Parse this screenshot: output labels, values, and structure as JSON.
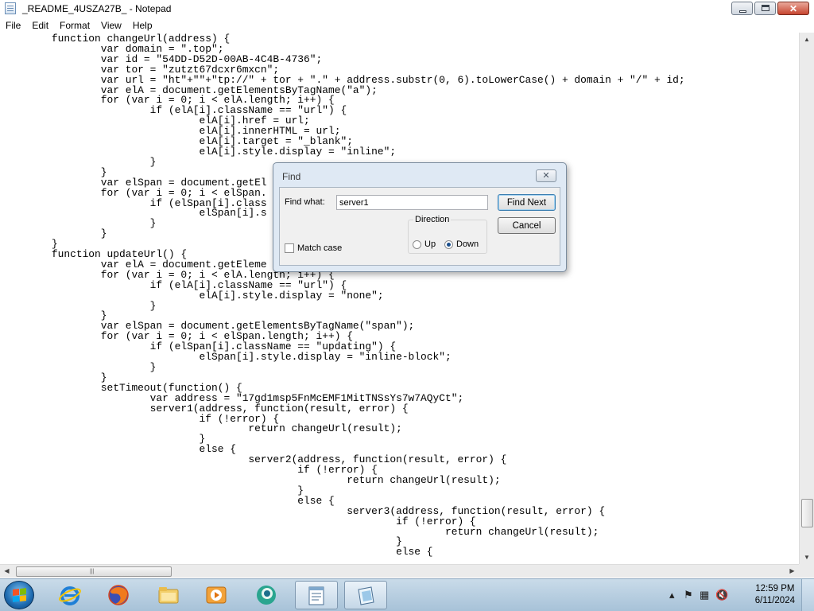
{
  "window": {
    "title": "_README_4USZA27B_ - Notepad"
  },
  "menu": [
    "File",
    "Edit",
    "Format",
    "View",
    "Help"
  ],
  "editor": {
    "lines": [
      "\tfunction changeUrl(address) {",
      "\t\tvar domain = \".top\";",
      "\t\tvar id = \"54DD-D52D-00AB-4C4B-4736\";",
      "\t\tvar tor = \"zutzt67dcxr6mxcn\";",
      "\t\tvar url = \"ht\"+\"\"+\"tp://\" + tor + \".\" + address.substr(0, 6).toLowerCase() + domain + \"/\" + id;",
      "\t\tvar elA = document.getElementsByTagName(\"a\");",
      "\t\tfor (var i = 0; i < elA.length; i++) {",
      "\t\t\tif (elA[i].className == \"url\") {",
      "\t\t\t\telA[i].href = url;",
      "\t\t\t\telA[i].innerHTML = url;",
      "\t\t\t\telA[i].target = \"_blank\";",
      "\t\t\t\telA[i].style.display = \"inline\";",
      "\t\t\t}",
      "\t\t}",
      "\t\tvar elSpan = document.getEl",
      "\t\tfor (var i = 0; i < elSpan.",
      "\t\t\tif (elSpan[i].class",
      "\t\t\t\telSpan[i].s",
      "\t\t\t}",
      "\t\t}",
      "\t}",
      "\tfunction updateUrl() {",
      "\t\tvar elA = document.getEleme",
      "\t\tfor (var i = 0; i < elA.length; i++) {",
      "\t\t\tif (elA[i].className == \"url\") {",
      "\t\t\t\telA[i].style.display = \"none\";",
      "\t\t\t}",
      "\t\t}",
      "\t\tvar elSpan = document.getElementsByTagName(\"span\");",
      "\t\tfor (var i = 0; i < elSpan.length; i++) {",
      "\t\t\tif (elSpan[i].className == \"updating\") {",
      "\t\t\t\telSpan[i].style.display = \"inline-block\";",
      "\t\t\t}",
      "\t\t}",
      "\t\tsetTimeout(function() {",
      "\t\t\tvar address = \"17gd1msp5FnMcEMF1MitTNSsYs7w7AQyCt\";",
      "\t\t\tserver1(address, function(result, error) {",
      "\t\t\t\tif (!error) {",
      "\t\t\t\t\treturn changeUrl(result);",
      "\t\t\t\t}",
      "\t\t\t\telse {",
      "\t\t\t\t\tserver2(address, function(result, error) {",
      "\t\t\t\t\t\tif (!error) {",
      "\t\t\t\t\t\t\treturn changeUrl(result);",
      "\t\t\t\t\t\t}",
      "\t\t\t\t\t\telse {",
      "\t\t\t\t\t\t\tserver3(address, function(result, error) {",
      "\t\t\t\t\t\t\t\tif (!error) {",
      "\t\t\t\t\t\t\t\t\treturn changeUrl(result);",
      "\t\t\t\t\t\t\t\t}",
      "\t\t\t\t\t\t\t\telse {"
    ]
  },
  "find_dialog": {
    "title": "Find",
    "find_what_label": "Find what:",
    "find_what_value": "server1",
    "find_next_label": "Find Next",
    "cancel_label": "Cancel",
    "direction_label": "Direction",
    "up_label": "Up",
    "down_label": "Down",
    "direction_selected": "Down",
    "match_case_label": "Match case",
    "match_case_checked": false
  },
  "taskbar": {
    "apps": [
      "internet-explorer-icon",
      "firefox-icon",
      "file-explorer-icon",
      "media-player-icon",
      "browser-app-icon",
      "notepad-task-icon",
      "document-task-icon"
    ],
    "clock_time": "12:59 PM",
    "clock_date": "6/11/2024"
  }
}
